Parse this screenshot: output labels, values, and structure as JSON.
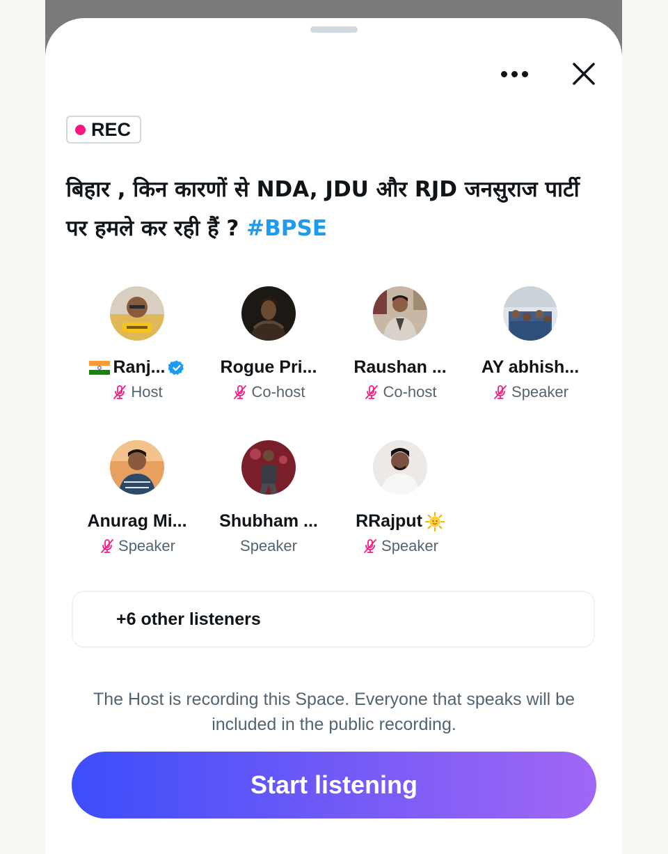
{
  "recording_badge": {
    "label": "REC",
    "color": "#f91880"
  },
  "space_title": {
    "text": "बिहार , किन कारणों से NDA, JDU और RJD जनसुराज पार्टी पर हमले कर रही हैं ?",
    "hashtag": "#BPSE"
  },
  "icons": {
    "more": "more-horizontal-icon",
    "close": "close-icon",
    "mic_muted": "mic-off-icon",
    "verified": "verified-badge-icon"
  },
  "participants": [
    {
      "name": "Ranj...",
      "prefix_emoji": "india-flag",
      "verified": true,
      "role": "Host",
      "muted": true
    },
    {
      "name": "Rogue Pri...",
      "role": "Co-host",
      "muted": true
    },
    {
      "name": "Raushan ...",
      "role": "Co-host",
      "muted": true
    },
    {
      "name": "AY abhish...",
      "role": "Speaker",
      "muted": true
    },
    {
      "name": "Anurag Mi...",
      "role": "Speaker",
      "muted": true
    },
    {
      "name": "Shubham ...",
      "role": "Speaker",
      "muted": false
    },
    {
      "name": "RRajput",
      "suffix_emoji": "sun-with-face",
      "role": "Speaker",
      "muted": true
    }
  ],
  "listeners": {
    "label": "+6 other listeners"
  },
  "recording_notice": "The Host is recording this Space. Everyone that speaks will be included in the public recording.",
  "start_button": {
    "label": "Start listening"
  },
  "colors": {
    "accent_pink": "#f91880",
    "hashtag_blue": "#1d9bf0",
    "button_gradient_start": "#3c4efa",
    "button_gradient_end": "#a167f5"
  }
}
